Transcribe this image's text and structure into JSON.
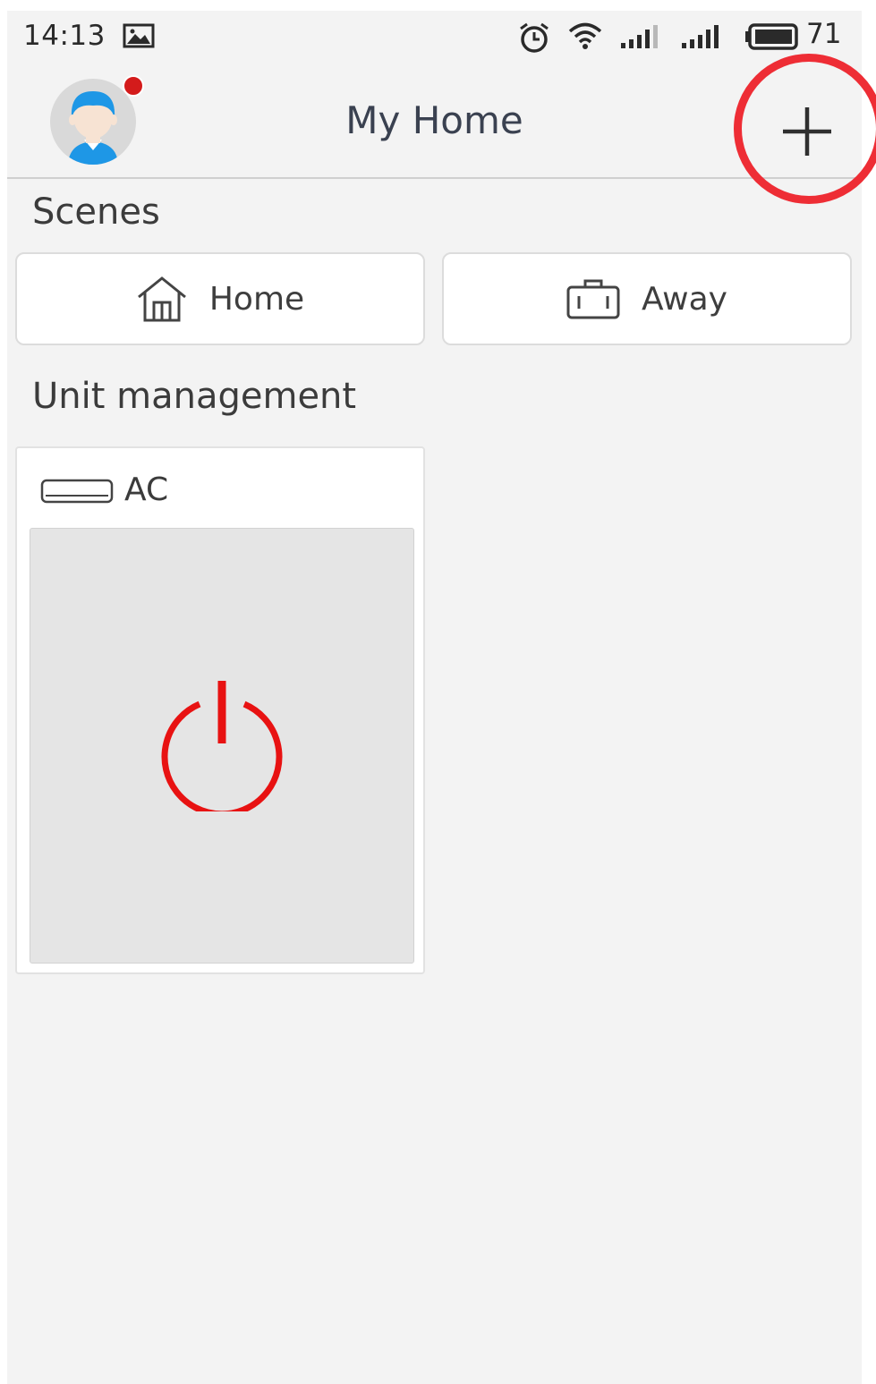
{
  "status_bar": {
    "time": "14:13",
    "battery_level": "71",
    "icons": [
      "gallery-icon",
      "alarm-icon",
      "wifi-icon",
      "signal-icon",
      "signal-icon",
      "battery-icon"
    ]
  },
  "header": {
    "title": "My Home",
    "has_notification": true,
    "add_icon": "plus-icon"
  },
  "scenes": {
    "title": "Scenes",
    "items": [
      {
        "label": "Home",
        "icon": "house-icon"
      },
      {
        "label": "Away",
        "icon": "suitcase-icon"
      }
    ]
  },
  "units": {
    "title": "Unit management",
    "items": [
      {
        "name": "AC",
        "icon": "air-conditioner-icon",
        "power_icon": "power-icon"
      }
    ]
  },
  "colors": {
    "background": "#f3f3f3",
    "power_red": "#e81212",
    "highlight_ring": "#ee2d35",
    "notification_dot": "#d41b1b",
    "avatar_blue": "#1e97e6"
  }
}
